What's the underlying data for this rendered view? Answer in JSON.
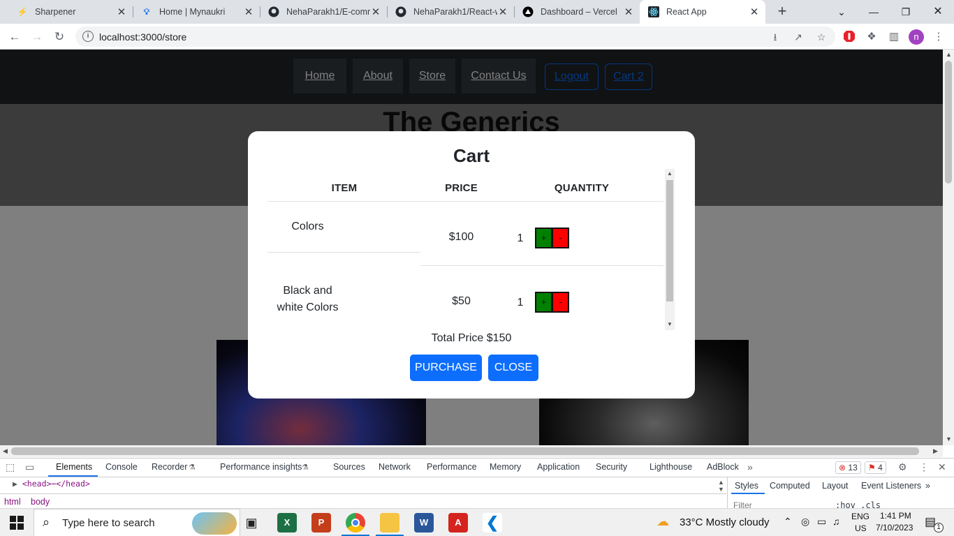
{
  "browser": {
    "tabs": [
      {
        "title": "Sharpener",
        "icon": "sharpener-icon",
        "active": false
      },
      {
        "title": "Home | Mynaukri",
        "icon": "mynaukri-icon",
        "active": false
      },
      {
        "title": "NehaParakh1/E-comm",
        "icon": "github-icon",
        "active": false
      },
      {
        "title": "NehaParakh1/React-w",
        "icon": "github-icon",
        "active": false
      },
      {
        "title": "Dashboard – Vercel",
        "icon": "vercel-icon",
        "active": false
      },
      {
        "title": "React App",
        "icon": "react-icon",
        "active": true
      }
    ],
    "url": "localhost:3000/store",
    "profile_initial": "n"
  },
  "site": {
    "nav": [
      "Home",
      "About",
      "Store",
      "Contact Us"
    ],
    "logout_label": "Logout",
    "cart_label": "Cart 2",
    "title": "The Generics"
  },
  "cart_modal": {
    "title": "Cart",
    "headers": {
      "item": "ITEM",
      "price": "PRICE",
      "quantity": "QUANTITY"
    },
    "items": [
      {
        "name": "Colors",
        "price": "$100",
        "quantity": "1",
        "plus": "+",
        "minus": "-"
      },
      {
        "name": "Black and white Colors",
        "price": "$50",
        "quantity": "1",
        "plus": "+",
        "minus": "-"
      }
    ],
    "total": "Total Price $150",
    "purchase_label": "PURCHASE",
    "close_label": "CLOSE",
    "colors": {
      "plus": "#008000",
      "minus": "#ff0000",
      "primary": "#0d6efd"
    }
  },
  "devtools": {
    "tabs": [
      "Elements",
      "Console",
      "Recorder",
      "Performance insights",
      "Sources",
      "Network",
      "Performance",
      "Memory",
      "Application",
      "Security",
      "Lighthouse",
      "AdBlock"
    ],
    "active_tab": "Elements",
    "errors_count": "13",
    "warnings_count": "4",
    "dom_line": "<head>⋯</head>",
    "breadcrumbs": [
      "html",
      "body"
    ],
    "styles_tabs": [
      "Styles",
      "Computed",
      "Layout",
      "Event Listeners"
    ],
    "filter_placeholder": "Filter",
    "hov_cls": ":hov .cls"
  },
  "taskbar": {
    "search_placeholder": "Type here to search",
    "weather": "33°C  Mostly cloudy",
    "lang_top": "ENG",
    "lang_bottom": "US",
    "time": "1:41 PM",
    "date": "7/10/2023",
    "notifications": "1"
  }
}
